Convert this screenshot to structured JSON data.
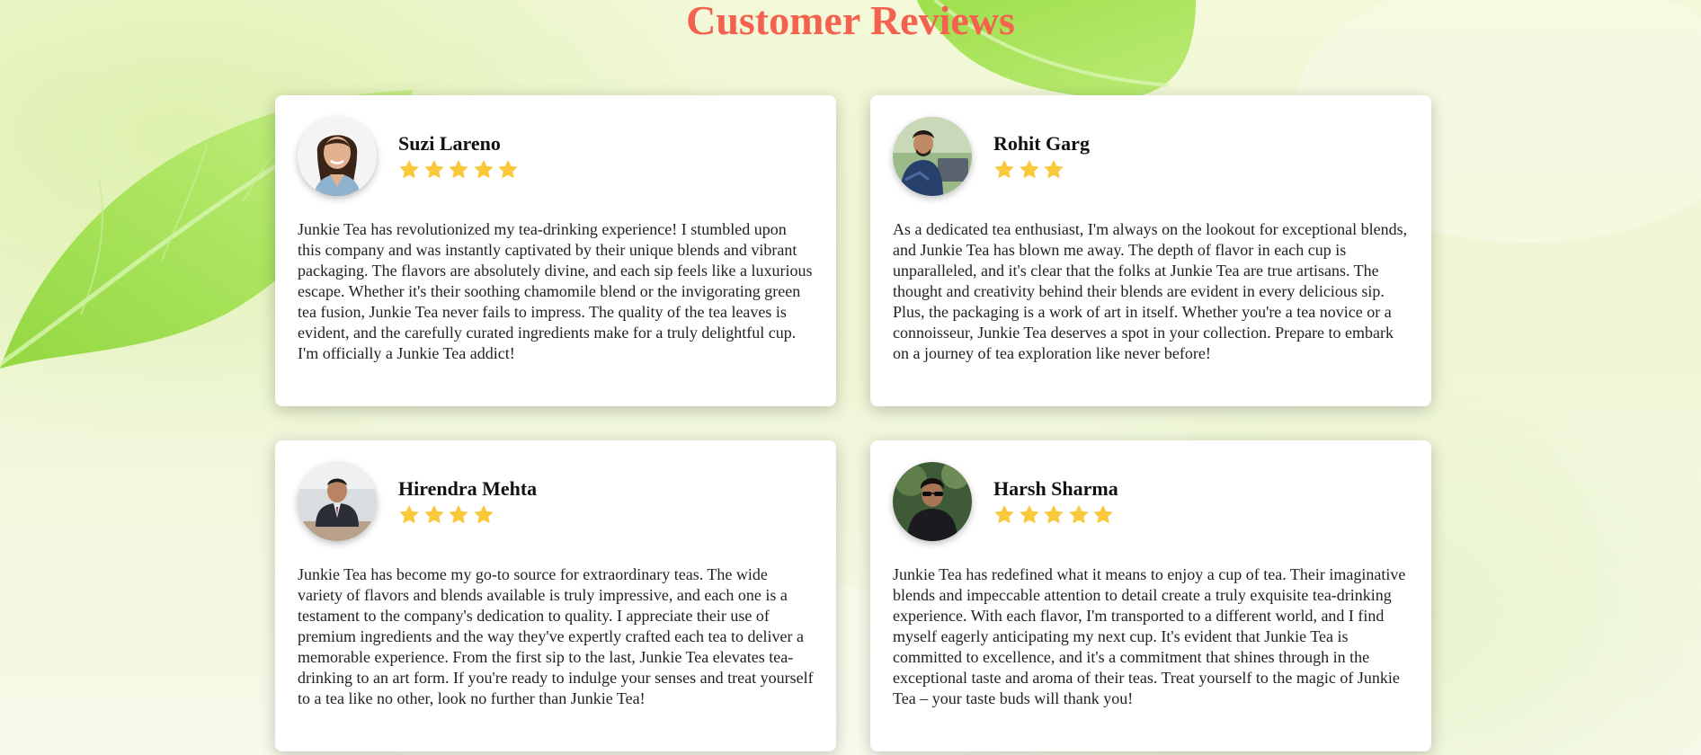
{
  "page": {
    "title": "Customer Reviews",
    "title_color": "#f5614f"
  },
  "icons": {
    "star": "star-icon",
    "star_color": "#f9c93b"
  },
  "reviews": [
    {
      "name": "Suzi Lareno",
      "rating": 5,
      "avatar": "woman-portrait-avatar",
      "text": "Junkie Tea has revolutionized my tea-drinking experience! I stumbled upon this company and was instantly captivated by their unique blends and vibrant packaging. The flavors are absolutely divine, and each sip feels like a luxurious escape. Whether it's their soothing chamomile blend or the invigorating green tea fusion, Junkie Tea never fails to impress. The quality of the tea leaves is evident, and the carefully curated ingredients make for a truly delightful cup. I'm officially a Junkie Tea addict!"
    },
    {
      "name": "Rohit Garg",
      "rating": 3,
      "avatar": "man-with-laptop-avatar",
      "text": "As a dedicated tea enthusiast, I'm always on the lookout for exceptional blends, and Junkie Tea has blown me away. The depth of flavor in each cup is unparalleled, and it's clear that the folks at Junkie Tea are true artisans. The thought and creativity behind their blends are evident in every delicious sip. Plus, the packaging is a work of art in itself. Whether you're a tea novice or a connoisseur, Junkie Tea deserves a spot in your collection. Prepare to embark on a journey of tea exploration like never before!"
    },
    {
      "name": "Hirendra Mehta",
      "rating": 4,
      "avatar": "man-in-suit-avatar",
      "text": "Junkie Tea has become my go-to source for extraordinary teas. The wide variety of flavors and blends available is truly impressive, and each one is a testament to the company's dedication to quality. I appreciate their use of premium ingredients and the way they've expertly crafted each tea to deliver a memorable experience. From the first sip to the last, Junkie Tea elevates tea-drinking to an art form. If you're ready to indulge your senses and treat yourself to a tea like no other, look no further than Junkie Tea!"
    },
    {
      "name": "Harsh Sharma",
      "rating": 5,
      "avatar": "man-with-sunglasses-avatar",
      "text": "Junkie Tea has redefined what it means to enjoy a cup of tea. Their imaginative blends and impeccable attention to detail create a truly exquisite tea-drinking experience. With each flavor, I'm transported to a different world, and I find myself eagerly anticipating my next cup. It's evident that Junkie Tea is committed to excellence, and it's a commitment that shines through in the exceptional taste and aroma of their teas. Treat yourself to the magic of Junkie Tea – your taste buds will thank you!"
    }
  ]
}
